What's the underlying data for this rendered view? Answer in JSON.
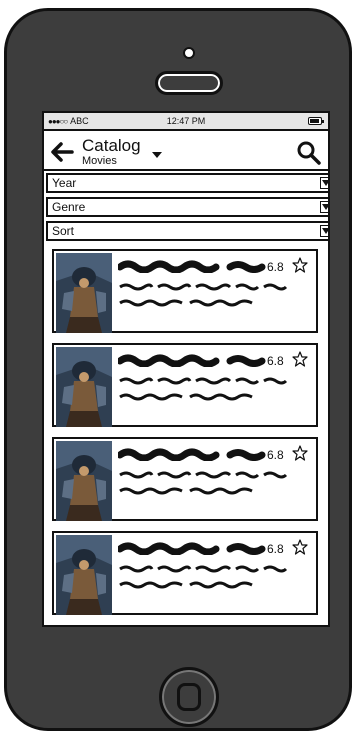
{
  "status_bar": {
    "carrier": "ABC",
    "time": "12:47 PM",
    "icons": [
      "signal-dots",
      "battery-icon"
    ]
  },
  "nav": {
    "title": "Catalog",
    "subtitle": "Movies",
    "icons": [
      "back-arrow-icon",
      "chevron-down-icon",
      "search-icon"
    ]
  },
  "filters": [
    {
      "label": "Year"
    },
    {
      "label": "Genre"
    },
    {
      "label": "Sort"
    }
  ],
  "items": [
    {
      "rating": "6.8"
    },
    {
      "rating": "6.8"
    },
    {
      "rating": "6.8"
    },
    {
      "rating": "6.8"
    }
  ],
  "colors": {
    "phone_body": "#3d3d3d",
    "outline": "#111111",
    "status_bar": "#e6e6e6"
  }
}
